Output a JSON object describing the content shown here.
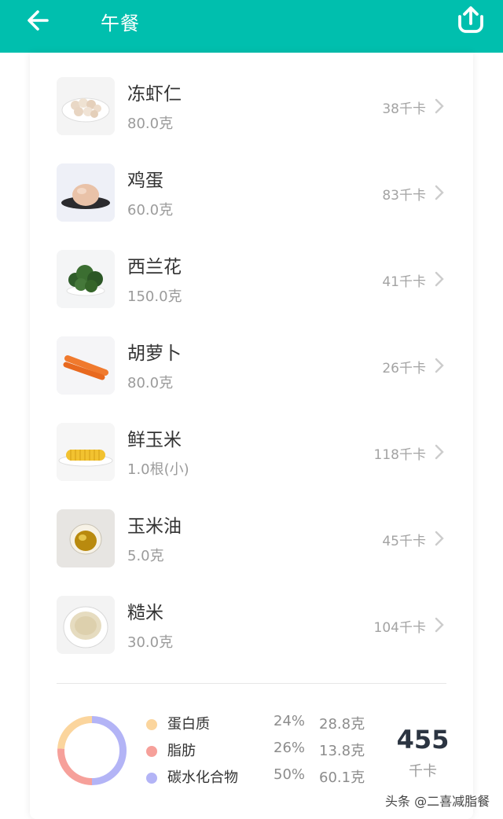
{
  "header": {
    "title": "午餐",
    "back_icon": "arrow-left-icon",
    "upload_icon": "upload-icon",
    "color": "#00bfae"
  },
  "foods": [
    {
      "name": "冻虾仁",
      "amount": "80.0克",
      "kcal": "38千卡",
      "image": "frozen-shrimp-image"
    },
    {
      "name": "鸡蛋",
      "amount": "60.0克",
      "kcal": "83千卡",
      "image": "egg-image"
    },
    {
      "name": "西兰花",
      "amount": "150.0克",
      "kcal": "41千卡",
      "image": "broccoli-image"
    },
    {
      "name": "胡萝卜",
      "amount": "80.0克",
      "kcal": "26千卡",
      "image": "carrot-image"
    },
    {
      "name": "鲜玉米",
      "amount": "1.0根(小)",
      "kcal": "118千卡",
      "image": "corn-image"
    },
    {
      "name": "玉米油",
      "amount": "5.0克",
      "kcal": "45千卡",
      "image": "corn-oil-image"
    },
    {
      "name": "糙米",
      "amount": "30.0克",
      "kcal": "104千卡",
      "image": "brown-rice-image"
    }
  ],
  "summary": {
    "nutrients": [
      {
        "name": "蛋白质",
        "percent": "24%",
        "grams": "28.8克",
        "color": "#fbd59d",
        "fraction": 0.24
      },
      {
        "name": "脂肪",
        "percent": "26%",
        "grams": "13.8克",
        "color": "#f6a09a",
        "fraction": 0.26
      },
      {
        "name": "碳水化合物",
        "percent": "50%",
        "grams": "60.1克",
        "color": "#b3b4f6",
        "fraction": 0.5
      }
    ],
    "total": "455",
    "total_unit": "千卡"
  },
  "watermark": "头条 @二喜减脂餐"
}
